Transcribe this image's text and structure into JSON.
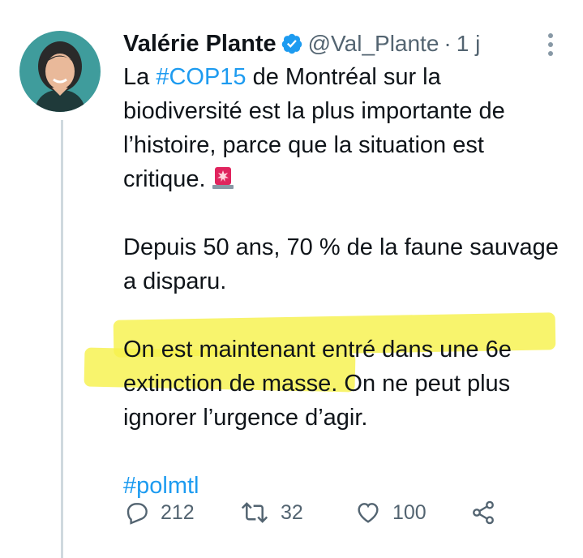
{
  "author": {
    "name": "Valérie Plante",
    "handle": "@Val_Plante",
    "separator": "·",
    "time": "1 j"
  },
  "tweet": {
    "line1_prefix": "La ",
    "hashtag_cop": "#COP15",
    "line1_suffix": " de Montréal sur la biodiversité est la plus importante de l’histoire, parce que la situation est critique.",
    "paragraph2": "Depuis 50 ans, 70 % de la faune sauvage a disparu.",
    "highlighted_text": "On est maintenant entré dans une 6e extinction de masse.",
    "paragraph3_rest": " On ne peut plus ignorer l’urgence d’agir.",
    "hashtag_polmtl": "#polmtl"
  },
  "actions": {
    "replies": "212",
    "retweets": "32",
    "likes": "100"
  },
  "colors": {
    "link": "#1d9bf0",
    "secondary_text": "#536471",
    "highlight": "#f6f24d",
    "verified": "#1d9bf0"
  },
  "icons": [
    "verified-badge-icon",
    "more-options-icon",
    "siren-emoji-icon",
    "reply-icon",
    "retweet-icon",
    "like-icon",
    "share-icon"
  ]
}
